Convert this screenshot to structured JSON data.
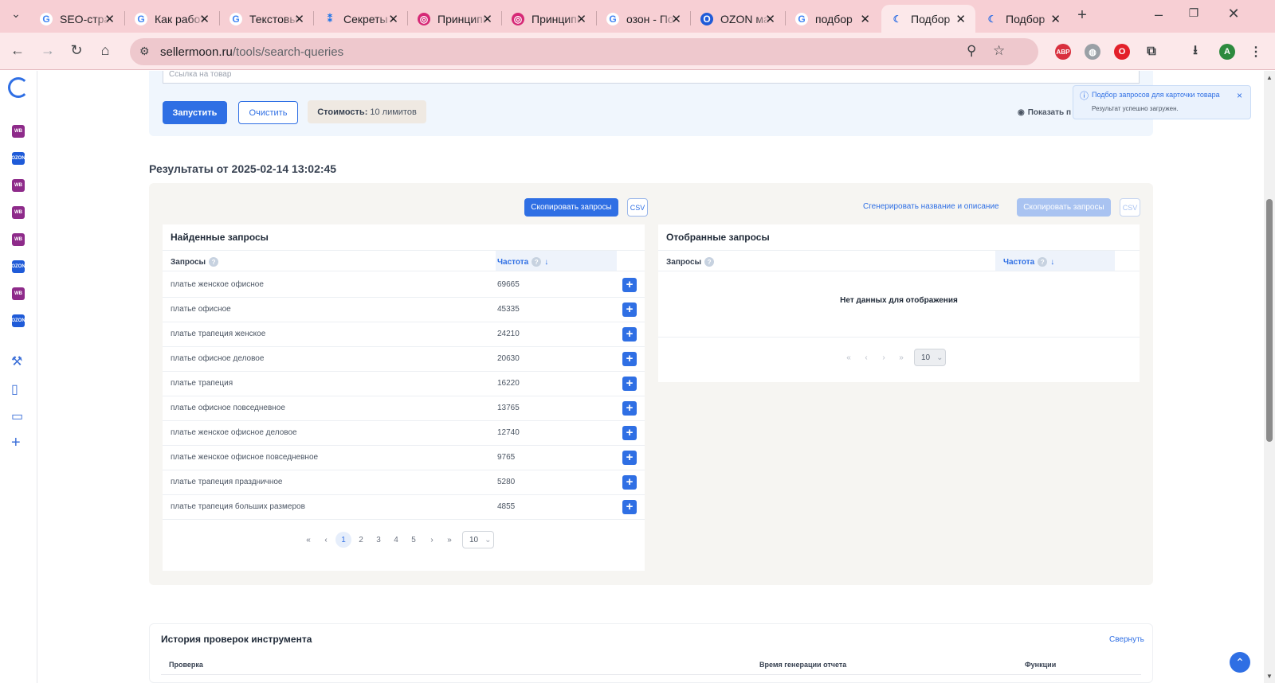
{
  "browser": {
    "tabs": [
      {
        "title": "SEO-страница",
        "icon": "google-icon"
      },
      {
        "title": "Как работать",
        "icon": "google-icon"
      },
      {
        "title": "Текстовые",
        "icon": "google-icon"
      },
      {
        "title": "Секреты",
        "icon": "spark-icon"
      },
      {
        "title": "Принципы",
        "icon": "instagram-icon"
      },
      {
        "title": "Принципы",
        "icon": "instagram-icon"
      },
      {
        "title": "озон - Поиск",
        "icon": "google-icon"
      },
      {
        "title": "OZON маркетплейс",
        "icon": "ozon-icon"
      },
      {
        "title": "подбор",
        "icon": "google-icon"
      },
      {
        "title": "Подбор",
        "icon": "sellermoon-icon",
        "active": true
      },
      {
        "title": "Подбор",
        "icon": "sellermoon-icon"
      }
    ],
    "url_host": "sellermoon.ru",
    "url_path": "/tools/search-queries",
    "profile_initial": "A"
  },
  "sidebar": {
    "marketplaces": [
      "WB",
      "OZON",
      "WB",
      "WB",
      "WB",
      "OZON",
      "WB",
      "OZON"
    ],
    "tools": [
      "wrench-icon",
      "document-icon",
      "ticket-icon",
      "plus-icon"
    ]
  },
  "form": {
    "link_placeholder": "Ссылка на товар",
    "run_button": "Запустить",
    "clear_button": "Очистить",
    "cost_label": "Стоимость:",
    "cost_value": "10 лимитов",
    "show_label": "Показать п"
  },
  "toast": {
    "title": "Подбор запросов для карточки товара",
    "message": "Результат успешно загружен.",
    "close": "×"
  },
  "results": {
    "title": "Результаты от 2025-02-14 13:02:45",
    "copy_button": "Скопировать запросы",
    "csv_button": "CSV",
    "generate_link": "Сгенерировать название и описание",
    "found": {
      "title": "Найденные запросы",
      "col_query": "Запросы",
      "col_freq": "Частота",
      "rows": [
        {
          "query": "платье женское офисное",
          "freq": "69665"
        },
        {
          "query": "платье офисное",
          "freq": "45335"
        },
        {
          "query": "платье трапеция женское",
          "freq": "24210"
        },
        {
          "query": "платье офисное деловое",
          "freq": "20630"
        },
        {
          "query": "платье трапеция",
          "freq": "16220"
        },
        {
          "query": "платье офисное повседневное",
          "freq": "13765"
        },
        {
          "query": "платье женское офисное деловое",
          "freq": "12740"
        },
        {
          "query": "платье женское офисное повседневное",
          "freq": "9765"
        },
        {
          "query": "платье трапеция праздничное",
          "freq": "5280"
        },
        {
          "query": "платье трапеция больших размеров",
          "freq": "4855"
        }
      ],
      "pages": [
        "1",
        "2",
        "3",
        "4",
        "5"
      ],
      "current_page": "1",
      "page_size": "10"
    },
    "selected": {
      "title": "Отобранные запросы",
      "col_query": "Запросы",
      "col_freq": "Частота",
      "empty": "Нет данных для отображения",
      "page_size": "10"
    }
  },
  "history": {
    "title": "История проверок инструмента",
    "collapse": "Свернуть",
    "columns": [
      "Проверка",
      "Время генерации отчета",
      "Функции"
    ]
  },
  "colors": {
    "accent": "#2f6fe4",
    "tabbar": "#f7cfd4",
    "wb": "#8e2b8a",
    "ozon": "#1f5bd8"
  }
}
